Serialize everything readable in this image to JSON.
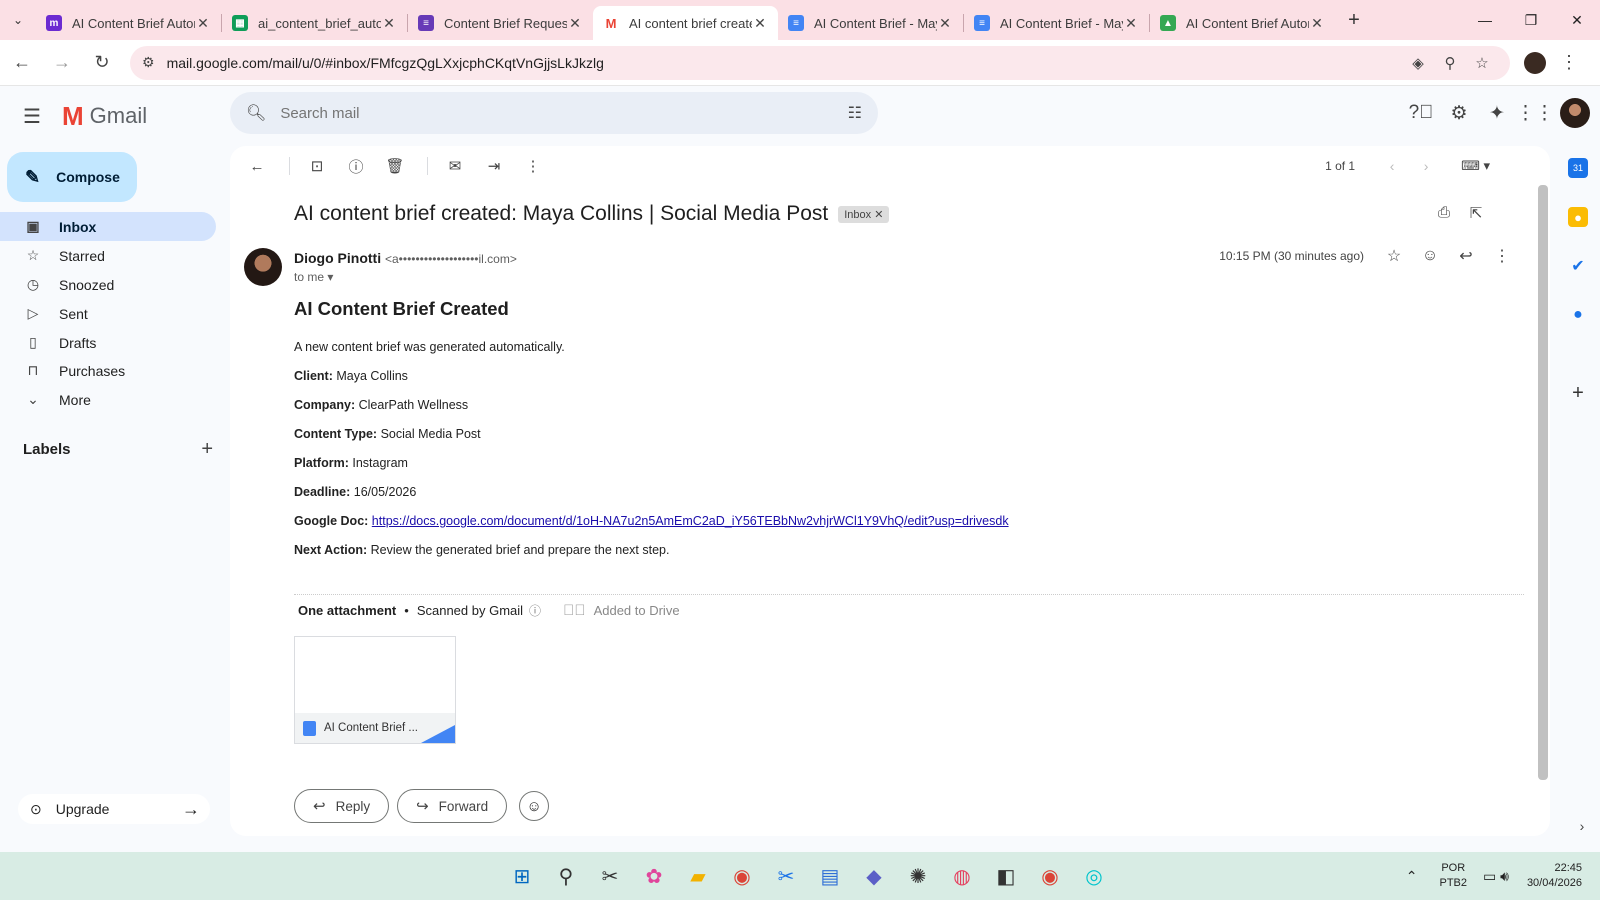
{
  "browser": {
    "tabs": [
      {
        "title": "AI Content Brief Autom",
        "icon": "make-icon",
        "color": "#6b2bd1",
        "active": false
      },
      {
        "title": "ai_content_brief_autom",
        "icon": "sheets-icon",
        "color": "#0f9d58",
        "active": false
      },
      {
        "title": "Content Brief Request F",
        "icon": "forms-icon",
        "color": "#673ab7",
        "active": false
      },
      {
        "title": "AI content brief created",
        "icon": "gmail-icon",
        "color": "#ea4335",
        "active": true
      },
      {
        "title": "AI Content Brief - May",
        "icon": "docs-icon",
        "color": "#4285f4",
        "active": false
      },
      {
        "title": "AI Content Brief - May",
        "icon": "docs-icon",
        "color": "#4285f4",
        "active": false
      },
      {
        "title": "AI Content Brief Autom",
        "icon": "drive-icon",
        "color": "#34a853",
        "active": false
      }
    ],
    "url": "mail.google.com/mail/u/0/#inbox/FMfcgzQgLXxjcphCKqtVnGjjsLkJkzlg"
  },
  "gmail": {
    "brand": "Gmail",
    "search_placeholder": "Search mail",
    "compose_label": "Compose",
    "nav": [
      {
        "label": "Inbox",
        "icon": "inbox-icon",
        "active": true
      },
      {
        "label": "Starred",
        "icon": "star-icon",
        "active": false
      },
      {
        "label": "Snoozed",
        "icon": "clock-icon",
        "active": false
      },
      {
        "label": "Sent",
        "icon": "send-icon",
        "active": false
      },
      {
        "label": "Drafts",
        "icon": "draft-icon",
        "active": false
      },
      {
        "label": "Purchases",
        "icon": "bag-icon",
        "active": false
      },
      {
        "label": "More",
        "icon": "chevron-down-icon",
        "active": false
      }
    ],
    "labels_heading": "Labels",
    "upgrade_label": "Upgrade"
  },
  "message": {
    "pager": "1 of 1",
    "subject": "AI content brief created: Maya Collins | Social Media Post",
    "badge": "Inbox",
    "sender_name": "Diogo Pinotti",
    "sender_email": "<a•••••••••••••••••••il.com>",
    "to": "to me",
    "time": "10:15 PM (30 minutes ago)",
    "heading": "AI Content Brief Created",
    "intro": "A new content brief was generated automatically.",
    "fields": {
      "client_label": "Client:",
      "client": "Maya Collins",
      "company_label": "Company:",
      "company": "ClearPath Wellness",
      "type_label": "Content Type:",
      "type": "Social Media Post",
      "platform_label": "Platform:",
      "platform": "Instagram",
      "deadline_label": "Deadline:",
      "deadline": "16/05/2026",
      "doc_label": "Google Doc:",
      "doc_url": "https://docs.google.com/document/d/1oH-NA7u2n5AmEmC2aD_iY56TEBbNw2vhjrWCl1Y9VhQ/edit?usp=drivesdk",
      "next_label": "Next Action:",
      "next": "Review the generated brief and prepare the next step."
    },
    "attachment": {
      "count_label": "One attachment",
      "scanned": "Scanned by Gmail",
      "added": "Added to Drive",
      "file_name": "AI Content Brief ..."
    },
    "reply_label": "Reply",
    "forward_label": "Forward"
  },
  "taskbar": {
    "lang_1": "POR",
    "lang_2": "PTB2",
    "time": "22:45",
    "date": "30/04/2026"
  }
}
